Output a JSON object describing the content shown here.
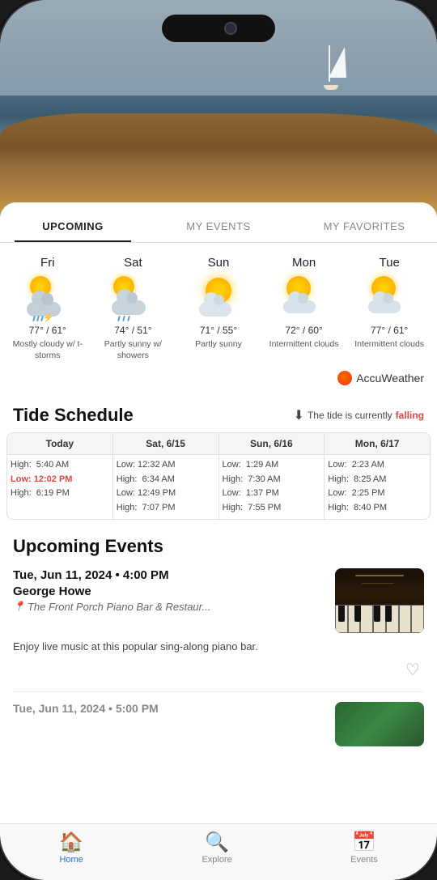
{
  "phone": {
    "tabs": [
      {
        "id": "upcoming",
        "label": "UPCOMING",
        "active": true
      },
      {
        "id": "my-events",
        "label": "MY EVENTS",
        "active": false
      },
      {
        "id": "my-favorites",
        "label": "MY FAVORITES",
        "active": false
      }
    ],
    "weather": {
      "brand": "AccuWeather",
      "days": [
        {
          "name": "Fri",
          "icon": "storm",
          "high": "77°",
          "low": "61°",
          "desc": "Mostly cloudy w/ t-storms"
        },
        {
          "name": "Sat",
          "icon": "partly-cloudy-rain",
          "high": "74°",
          "low": "51°",
          "desc": "Partly sunny w/ showers"
        },
        {
          "name": "Sun",
          "icon": "partly-sunny",
          "high": "71°",
          "low": "55°",
          "desc": "Partly sunny"
        },
        {
          "name": "Mon",
          "icon": "intermittent-clouds",
          "high": "72°",
          "low": "60°",
          "desc": "Intermittent clouds"
        },
        {
          "name": "Tue",
          "icon": "intermittent-clouds",
          "high": "77°",
          "low": "61°",
          "desc": "Intermittent clouds"
        }
      ]
    },
    "tide": {
      "title": "Tide Schedule",
      "status_prefix": "The tide is currently",
      "status_value": "falling",
      "columns": [
        {
          "header": "Today",
          "entries": [
            {
              "label": "High:",
              "time": "5:40 AM",
              "highlight": false
            },
            {
              "label": "Low:",
              "time": "12:02 PM",
              "highlight": true
            },
            {
              "label": "High:",
              "time": "6:19 PM",
              "highlight": false
            }
          ]
        },
        {
          "header": "Sat, 6/15",
          "entries": [
            {
              "label": "Low:",
              "time": "12:32 AM",
              "highlight": false
            },
            {
              "label": "High:",
              "time": "6:34 AM",
              "highlight": false
            },
            {
              "label": "Low:",
              "time": "12:49 PM",
              "highlight": false
            },
            {
              "label": "High:",
              "time": "7:07 PM",
              "highlight": false
            }
          ]
        },
        {
          "header": "Sun, 6/16",
          "entries": [
            {
              "label": "Low:",
              "time": "1:29 AM",
              "highlight": false
            },
            {
              "label": "High:",
              "time": "7:30 AM",
              "highlight": false
            },
            {
              "label": "Low:",
              "time": "1:37 PM",
              "highlight": false
            },
            {
              "label": "High:",
              "time": "7:55 PM",
              "highlight": false
            }
          ]
        },
        {
          "header": "Mon, 6/17",
          "entries": [
            {
              "label": "Low:",
              "time": "2:23 AM",
              "highlight": false
            },
            {
              "label": "High:",
              "time": "8:25 AM",
              "highlight": false
            },
            {
              "label": "Low:",
              "time": "2:25 PM",
              "highlight": false
            },
            {
              "label": "High:",
              "time": "8:40 PM",
              "highlight": false
            }
          ]
        }
      ]
    },
    "events": {
      "section_title": "Upcoming Events",
      "items": [
        {
          "date": "Tue, Jun 11, 2024 • 4:00 PM",
          "name": "George Howe",
          "location": "The Front Porch Piano Bar & Restaur...",
          "desc": "Enjoy live music at this popular sing-along piano bar.",
          "image_type": "piano"
        },
        {
          "date": "Tue, Jun 11, 2024 • 5:00 PM",
          "name": "",
          "location": "",
          "desc": "",
          "image_type": "outdoor"
        }
      ]
    },
    "bottom_nav": [
      {
        "id": "home",
        "label": "Home",
        "icon": "🏠",
        "active": true
      },
      {
        "id": "explore",
        "label": "Explore",
        "icon": "🔍",
        "active": false
      },
      {
        "id": "events",
        "label": "Events",
        "icon": "📅",
        "active": false
      }
    ]
  }
}
